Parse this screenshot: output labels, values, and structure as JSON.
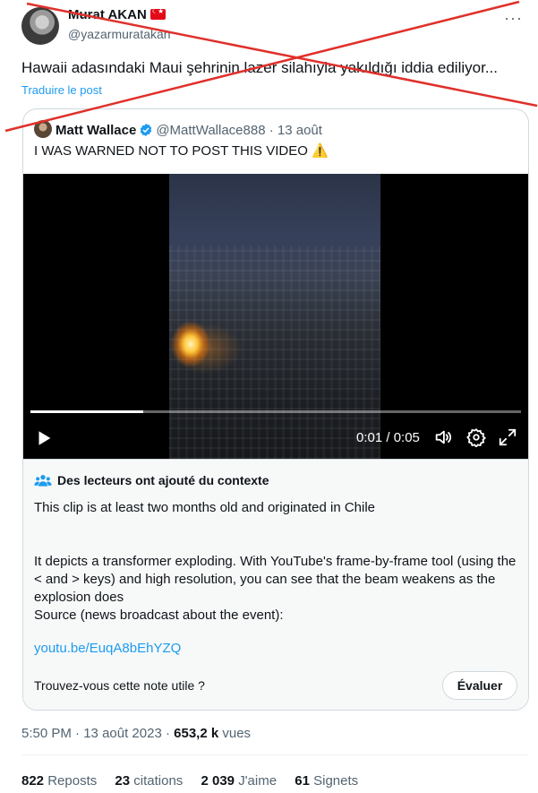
{
  "author": {
    "name": "Murat AKAN",
    "handle": "@yazarmuratakan",
    "flag_icon": "turkey-flag-icon"
  },
  "post": {
    "text": "Hawaii adasındaki Maui şehrinin lazer silahıyla yakıldığı iddia ediliyor...",
    "translate_label": "Traduire le post",
    "crossed_out": true,
    "cross_color": "#e0302a"
  },
  "quoted": {
    "name": "Matt Wallace",
    "verified": true,
    "handle": "@MattWallace888",
    "separator": " · ",
    "date": "13 août",
    "text": "I WAS WARNED NOT TO POST THIS VIDEO ⚠️",
    "video": {
      "time": "0:01 / 0:05",
      "progress": 0.23,
      "controls": [
        "play-icon",
        "volume-icon",
        "settings-icon",
        "fullscreen-icon"
      ]
    }
  },
  "community_note": {
    "title": "Des lecteurs ont ajouté du contexte",
    "paragraph_1": "This clip is at least two months old and originated in Chile",
    "paragraph_2": "It depicts a transformer exploding. With YouTube's frame-by-frame tool (using the < and > keys) and high resolution, you can see that the beam weakens as the explosion does",
    "paragraph_3": "Source (news broadcast about the event):",
    "link": "youtu.be/EuqA8bEhYZQ",
    "question": "Trouvez-vous cette note utile ?",
    "rate_label": "Évaluer"
  },
  "meta": {
    "time": "5:50 PM",
    "sep": " · ",
    "date": "13 août 2023",
    "sep2": " · ",
    "views_count": "653,2 k",
    "views_label": "vues"
  },
  "stats": [
    {
      "count": "822",
      "label": "Reposts"
    },
    {
      "count": "23",
      "label": "citations"
    },
    {
      "count": "2 039",
      "label": "J'aime"
    },
    {
      "count": "61",
      "label": "Signets"
    }
  ],
  "colors": {
    "link_blue": "#1d9bf0",
    "secondary_text": "#536471",
    "border": "#cfd9de",
    "note_bg": "#f7f9f9"
  }
}
